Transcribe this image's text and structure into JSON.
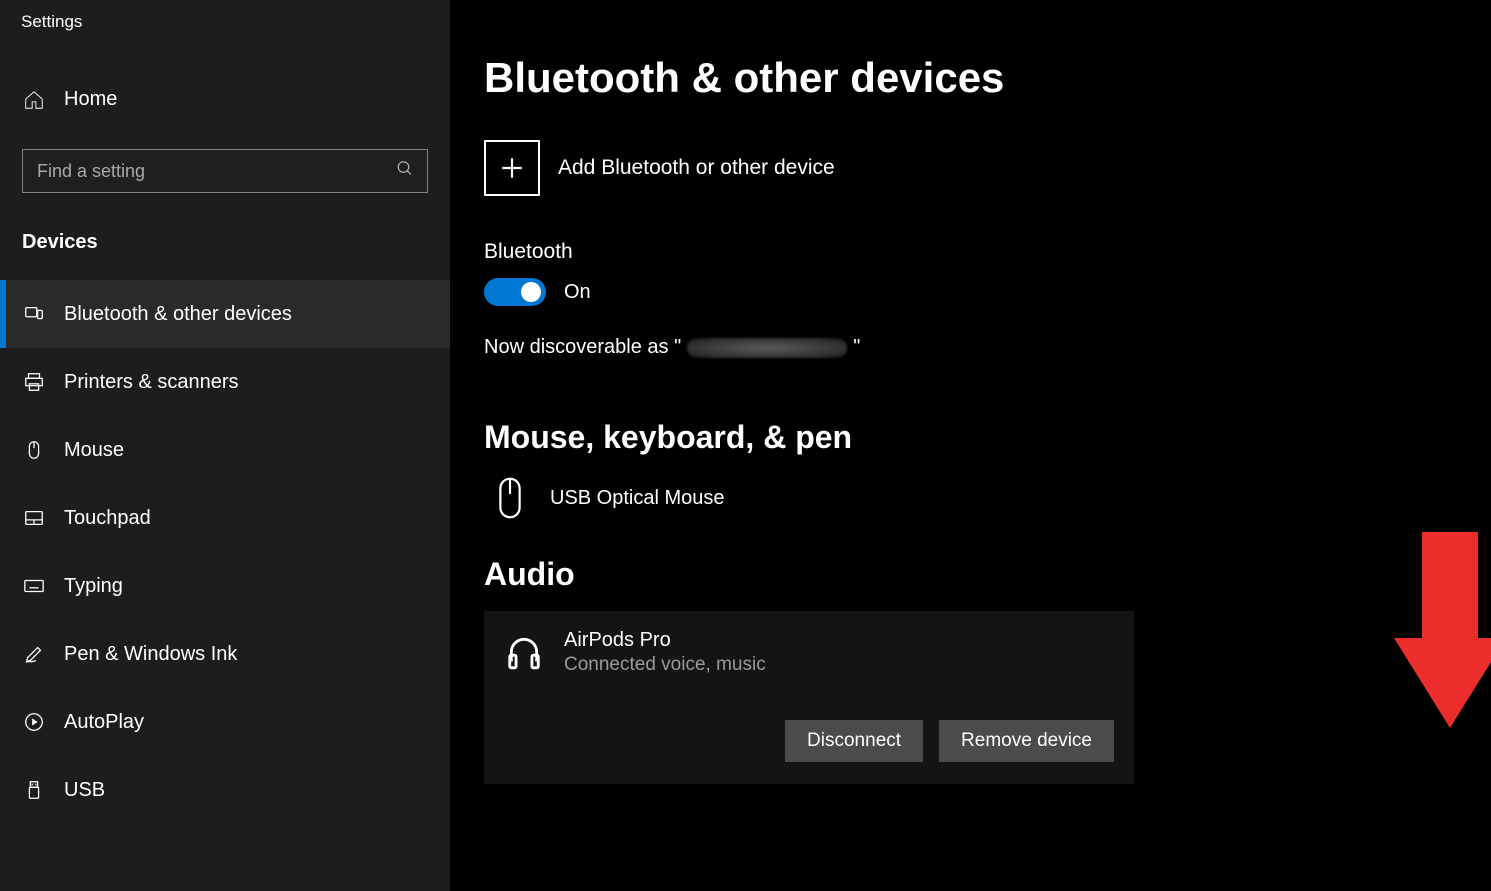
{
  "app_title": "Settings",
  "home_label": "Home",
  "search": {
    "placeholder": "Find a setting"
  },
  "category_label": "Devices",
  "sidebar": {
    "items": [
      {
        "label": "Bluetooth & other devices",
        "active": true
      },
      {
        "label": "Printers & scanners"
      },
      {
        "label": "Mouse"
      },
      {
        "label": "Touchpad"
      },
      {
        "label": "Typing"
      },
      {
        "label": "Pen & Windows Ink"
      },
      {
        "label": "AutoPlay"
      },
      {
        "label": "USB"
      }
    ]
  },
  "main": {
    "title": "Bluetooth & other devices",
    "add_device_label": "Add Bluetooth or other device",
    "bluetooth_heading": "Bluetooth",
    "bluetooth_state": "On",
    "discoverable_prefix": "Now discoverable as \"",
    "discoverable_suffix": "\"",
    "section_mkp": "Mouse, keyboard, & pen",
    "mkp_device": "USB Optical Mouse",
    "section_audio": "Audio",
    "audio_device": {
      "name": "AirPods Pro",
      "status": "Connected voice, music"
    },
    "disconnect_label": "Disconnect",
    "remove_label": "Remove device"
  }
}
